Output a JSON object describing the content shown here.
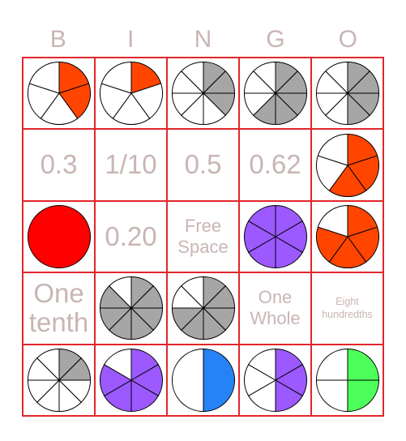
{
  "header": {
    "letters": [
      "B",
      "I",
      "N",
      "G",
      "O"
    ]
  },
  "colors": {
    "border": "#e3262b",
    "text": "#c9b5b5",
    "gray": "#a6a6a6",
    "orange": "#ff4500",
    "red": "#ff0000",
    "purple": "#9b59ff",
    "blue": "#2583f5",
    "green": "#4dff5a"
  },
  "cells": [
    {
      "type": "pie",
      "slices": 5,
      "filled": 2,
      "color": "#ff4500"
    },
    {
      "type": "pie",
      "slices": 5,
      "filled": 1,
      "color": "#ff4500"
    },
    {
      "type": "pie",
      "slices": 8,
      "filled": 3,
      "color": "#a6a6a6"
    },
    {
      "type": "pie",
      "slices": 8,
      "filled": 5,
      "color": "#a6a6a6"
    },
    {
      "type": "pie",
      "slices": 8,
      "filled": 4,
      "color": "#a6a6a6"
    },
    {
      "type": "text",
      "text": "0.3",
      "size": "big"
    },
    {
      "type": "text",
      "text": "1/10",
      "size": "big"
    },
    {
      "type": "text",
      "text": "0.5",
      "size": "big"
    },
    {
      "type": "text",
      "text": "0.62",
      "size": "big"
    },
    {
      "type": "pie",
      "slices": 5,
      "filled": 3,
      "color": "#ff4500"
    },
    {
      "type": "pie",
      "slices": 1,
      "filled": 1,
      "color": "#ff0000"
    },
    {
      "type": "text",
      "text": "0.20",
      "size": "big"
    },
    {
      "type": "text",
      "text": "Free Space",
      "size": "mid"
    },
    {
      "type": "pie",
      "slices": 6,
      "filled": 6,
      "color": "#9b59ff"
    },
    {
      "type": "pie",
      "slices": 5,
      "filled": 4,
      "color": "#ff4500"
    },
    {
      "type": "text",
      "text": "One tenth",
      "size": "big"
    },
    {
      "type": "pie",
      "slices": 8,
      "filled": 7,
      "color": "#a6a6a6"
    },
    {
      "type": "pie",
      "slices": 8,
      "filled": 6,
      "color": "#a6a6a6"
    },
    {
      "type": "text",
      "text": "One Whole",
      "size": "mid"
    },
    {
      "type": "text",
      "text": "Eight hundredths",
      "size": "small"
    },
    {
      "type": "pie",
      "slices": 8,
      "filled": 2,
      "color": "#a6a6a6"
    },
    {
      "type": "pie",
      "slices": 6,
      "filled": 5,
      "color": "#9b59ff"
    },
    {
      "type": "pie",
      "slices": 2,
      "filled": 1,
      "color": "#2583f5"
    },
    {
      "type": "pie",
      "slices": 6,
      "filled": 3,
      "color": "#9b59ff"
    },
    {
      "type": "pie",
      "slices": 4,
      "filled": 2,
      "color": "#4dff5a"
    }
  ]
}
